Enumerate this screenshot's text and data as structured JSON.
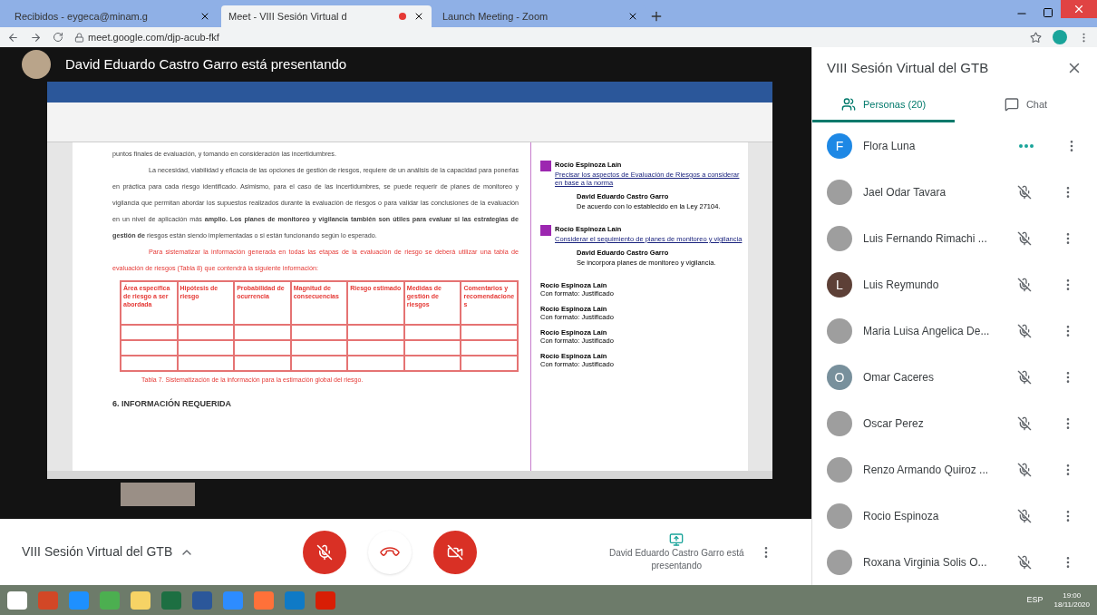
{
  "browser": {
    "tabs": [
      {
        "title": "Recibidos - eygeca@minam.g",
        "selected": false
      },
      {
        "title": "Meet - VIII Sesión Virtual d",
        "selected": true,
        "recording": true
      },
      {
        "title": "Launch Meeting - Zoom",
        "selected": false
      }
    ],
    "url": "meet.google.com/djp-acub-fkf"
  },
  "presenter": {
    "banner": "David Eduardo Castro Garro está presentando"
  },
  "document": {
    "paragraphs": [
      {
        "kind": "plain",
        "text": "puntos finales de evaluación, y tomando en consideración las incertidumbres."
      },
      {
        "kind": "body",
        "text": "La necesidad, viabilidad y eficacia de las opciones de gestión de riesgos, requiere de un análisis de la capacidad para ponerlas en práctica para cada riesgo identificado. Asimismo, para el caso de las incertidumbres, se puede requerir de planes de monitoreo y vigilancia que permitan abordar los supuestos realizados durante la evaluación de riesgos o para validar las conclusiones de la evaluación en un nivel de aplicación más **amplio. Los planes de monitoreo y vigilancia también son útiles para evaluar si las estrategias de gestión de** riesgos están siendo implementadas o si están funcionando según lo esperado."
      },
      {
        "kind": "red",
        "text": "Para sistematizar la información generada en todas las etapas de la evaluación de riesgo se deberá utilizar una tabla de evaluación de riesgos (Tabla 8) que contendrá la siguiente información:"
      }
    ],
    "table": {
      "columns": [
        "Área específica de riesgo a ser abordada",
        "Hipótesis de riesgo",
        "Probabilidad de ocurrencia",
        "Magnitud de consecuencias",
        "Riesgo estimado",
        "Medidas de gestión de riesgos",
        "Comentarios y recomendaciones"
      ]
    },
    "caption": "Tabla 7. Sistematización de la información para la estimación global del riesgo.",
    "heading": "6. INFORMACIÓN REQUERIDA",
    "comments": [
      {
        "kind": "comment",
        "author": "Rocío Espinoza Laín",
        "text": "Precisar los aspectos de Evaluación de Riesgos a considerar en base a la norma",
        "reply_author": "David Eduardo Castro Garro",
        "reply": "De acuerdo con lo establecido en la Ley 27104."
      },
      {
        "kind": "comment",
        "author": "Rocío Espinoza Laín",
        "text": "Considerar el seguimiento de planes de monitoreo y vigilancia",
        "reply_author": "David Eduardo Castro Garro",
        "reply": "Se incorpora planes de monitoreo y vigilancia."
      },
      {
        "kind": "format",
        "author": "Rocío Espinoza Laín",
        "text": "Con formato: Justificado"
      },
      {
        "kind": "format",
        "author": "Rocío Espinoza Laín",
        "text": "Con formato: Justificado"
      },
      {
        "kind": "format",
        "author": "Rocío Espinoza Laín",
        "text": "Con formato: Justificado"
      },
      {
        "kind": "format",
        "author": "Rocío Espinoza Laín",
        "text": "Con formato: Justificado"
      }
    ]
  },
  "meeting": {
    "title": "VIII Sesión Virtual del GTB",
    "mic_on": false,
    "camera_on": false,
    "presenting_label": "David Eduardo Castro Garro está presentando"
  },
  "panel": {
    "title": "VIII Sesión Virtual del GTB",
    "tabs": [
      {
        "label": "Personas (20)",
        "selected": true
      },
      {
        "label": "Chat",
        "selected": false
      }
    ],
    "people": [
      {
        "name": "Flora Luna",
        "kind": "letter",
        "letter": "F",
        "color": "#1e88e5",
        "speaking": true
      },
      {
        "name": "Jael Odar Tavara",
        "kind": "photo",
        "speaking": false
      },
      {
        "name": "Luis Fernando Rimachi ...",
        "kind": "photo",
        "speaking": false
      },
      {
        "name": "Luis Reymundo",
        "kind": "letter",
        "letter": "L",
        "color": "#5d4037",
        "speaking": false
      },
      {
        "name": "Maria Luisa Angelica De...",
        "kind": "photo",
        "speaking": false
      },
      {
        "name": "Omar Caceres",
        "kind": "letter",
        "letter": "O",
        "color": "#78909c",
        "speaking": false
      },
      {
        "name": "Oscar Perez",
        "kind": "photo",
        "speaking": false
      },
      {
        "name": "Renzo Armando Quiroz ...",
        "kind": "photo",
        "speaking": false
      },
      {
        "name": "Rocio Espinoza",
        "kind": "photo",
        "speaking": false
      },
      {
        "name": "Roxana Virginia Solis O...",
        "kind": "photo",
        "speaking": false
      }
    ]
  },
  "taskbar": {
    "apps": [
      {
        "kind": "windows"
      },
      {
        "kind": "powerpoint"
      },
      {
        "kind": "ie"
      },
      {
        "kind": "chrome"
      },
      {
        "kind": "files"
      },
      {
        "kind": "excel"
      },
      {
        "kind": "word"
      },
      {
        "kind": "zoom"
      },
      {
        "kind": "firefox"
      },
      {
        "kind": "edge"
      },
      {
        "kind": "acrobat"
      }
    ],
    "lang": "ESP",
    "time": "19:00",
    "date": "18/11/2020"
  }
}
